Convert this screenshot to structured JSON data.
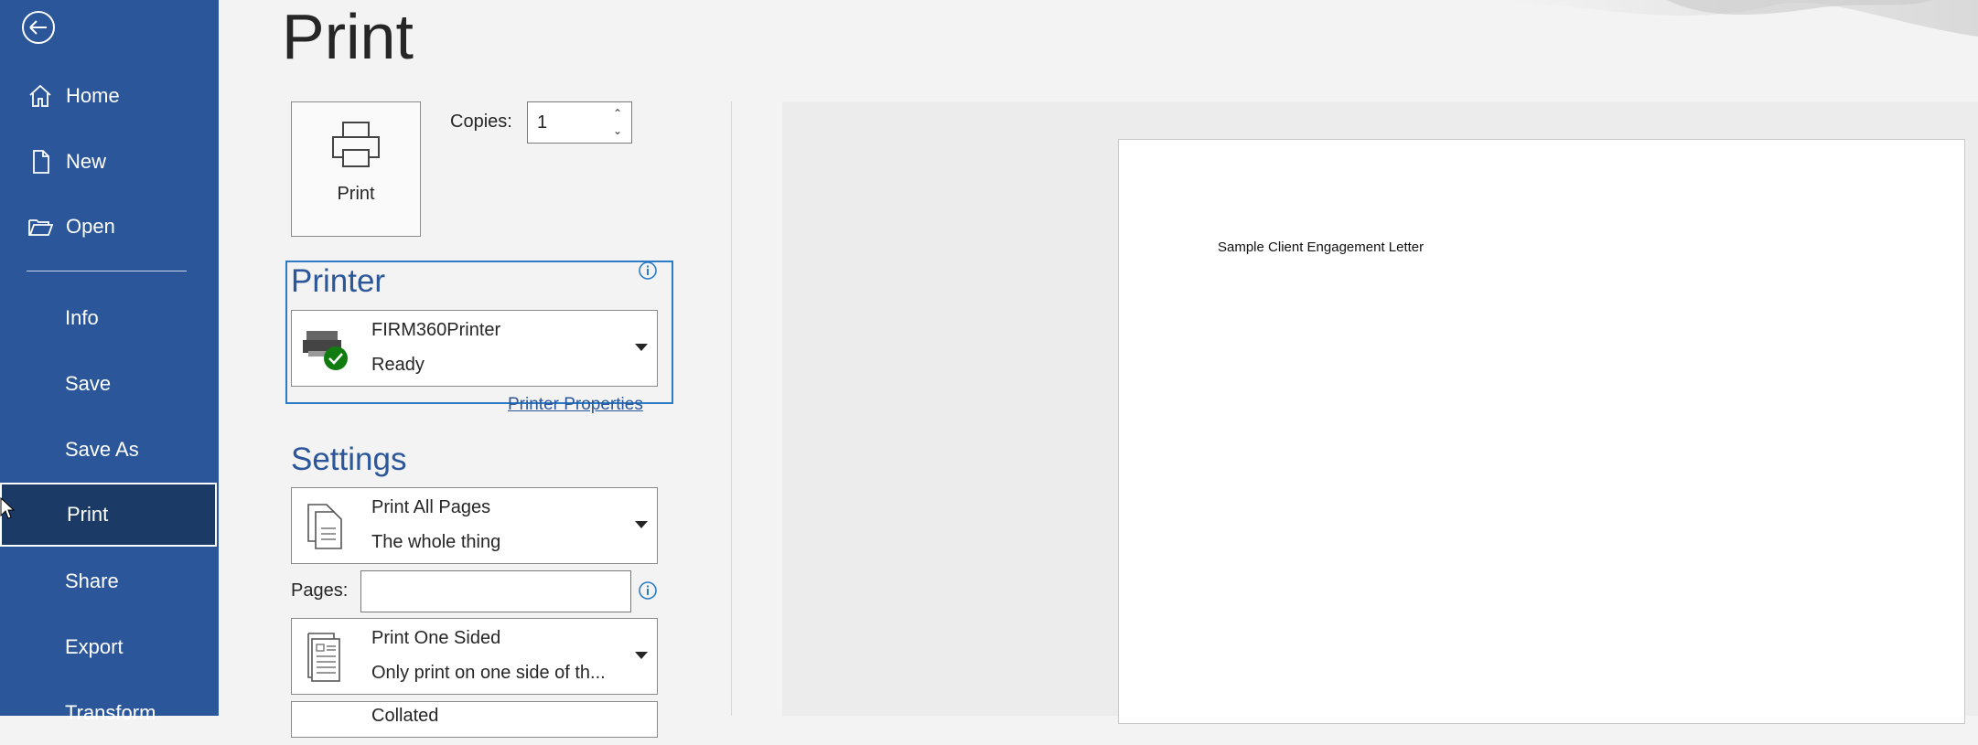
{
  "nav": {
    "items": [
      {
        "label": "Home",
        "icon": "home-icon"
      },
      {
        "label": "New",
        "icon": "new-document-icon"
      },
      {
        "label": "Open",
        "icon": "folder-open-icon"
      },
      {
        "label": "Info"
      },
      {
        "label": "Save"
      },
      {
        "label": "Save As"
      },
      {
        "label": "Print",
        "selected": true
      },
      {
        "label": "Share"
      },
      {
        "label": "Export"
      },
      {
        "label": "Transform"
      }
    ],
    "bg_color": "#2b579a",
    "selected_color": "#1b3a66"
  },
  "header": {
    "title": "Print"
  },
  "print_button": {
    "label": "Print"
  },
  "copies": {
    "label": "Copies:",
    "value": "1"
  },
  "printer": {
    "heading": "Printer",
    "name": "FIRM360Printer",
    "status": "Ready",
    "properties_link": "Printer Properties"
  },
  "settings": {
    "heading": "Settings",
    "pages_range": {
      "title": "Print All Pages",
      "subtitle": "The whole thing"
    },
    "pages_label": "Pages:",
    "pages_value": "",
    "sides": {
      "title": "Print One Sided",
      "subtitle": "Only print on one side of th..."
    },
    "collate": {
      "title": "Collated"
    }
  },
  "preview": {
    "document_line": "Sample Client Engagement Letter"
  },
  "colors": {
    "accent": "#2b579a",
    "focus_border": "#2b7bc6",
    "ready_green": "#107c10"
  }
}
